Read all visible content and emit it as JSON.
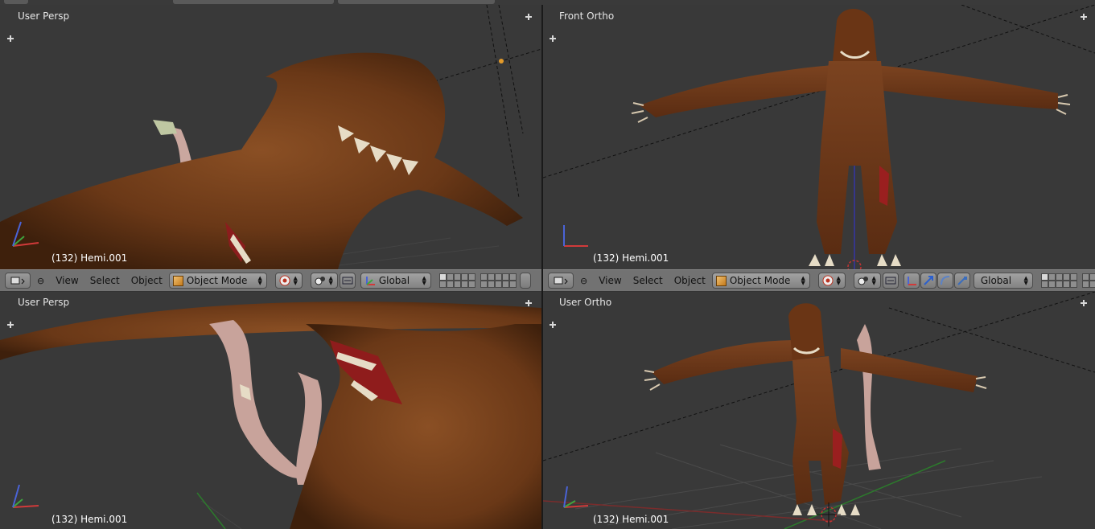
{
  "app": "Blender",
  "colors": {
    "viewport_bg": "#393939",
    "header_bg": "#727272",
    "skin": "#6b3a1a",
    "x_axis": "#d13a3a",
    "y_axis": "#3ea53e",
    "z_axis": "#4a63d6"
  },
  "viewports": {
    "tl": {
      "label": "User Persp",
      "object_info": "(132) Hemi.001"
    },
    "tr": {
      "label": "Front Ortho",
      "object_info": "(132) Hemi.001"
    },
    "bl": {
      "label": "User Persp",
      "object_info": "(132) Hemi.001"
    },
    "br": {
      "label": "User Ortho",
      "object_info": "(132) Hemi.001"
    }
  },
  "headers": {
    "left": {
      "menu": [
        "View",
        "Select",
        "Object"
      ],
      "mode": "Object Mode",
      "orientation": "Global"
    },
    "right": {
      "menu": [
        "View",
        "Select",
        "Object"
      ],
      "mode": "Object Mode",
      "orientation": "Global"
    }
  },
  "icons": {
    "editor_type": "3d-view-icon",
    "mode": "object-cube-icon",
    "pivot": "pivot-point-icon",
    "snap": "snap-icon",
    "manipulator": "manipulator-icon",
    "layers": "layers-grid-icon"
  }
}
